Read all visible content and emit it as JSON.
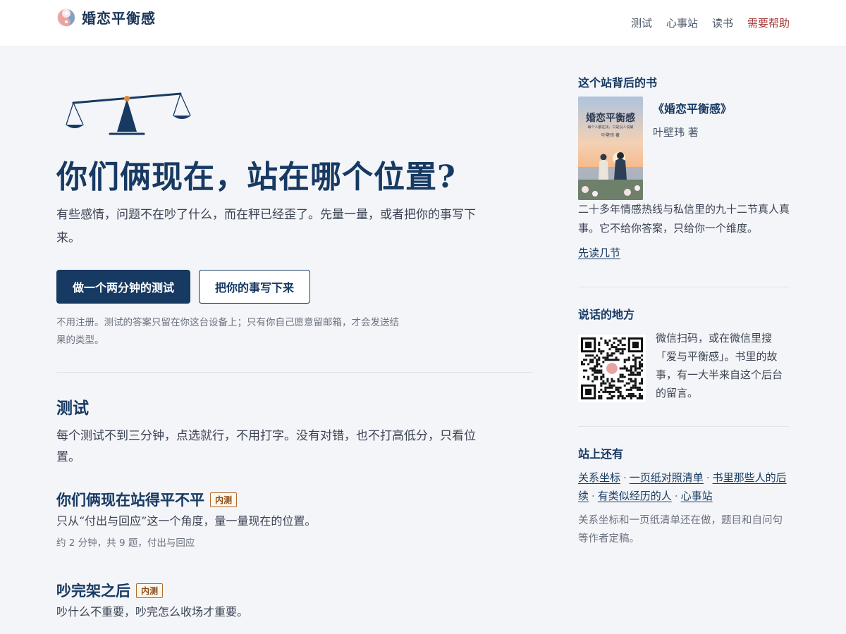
{
  "header": {
    "brand": "婚恋平衡感",
    "nav": {
      "test": "测试",
      "station": "心事站",
      "read": "读书",
      "help": "需要帮助"
    }
  },
  "hero": {
    "title": "你们俩现在，站在哪个位置?",
    "desc": "有些感情，问题不在吵了什么，而在秤已经歪了。先量一量，或者把你的事写下来。",
    "primary_button": "做一个两分钟的测试",
    "secondary_button": "把你的事写下来",
    "note": "不用注册。测试的答案只留在你这台设备上；只有你自己愿意留邮箱，才会发送结果的类型。"
  },
  "tests_section": {
    "title": "测试",
    "desc": "每个测试不到三分钟，点选就行，不用打字。没有对错，也不打高低分，只看位置。",
    "items": [
      {
        "title": "你们俩现在站得平不平",
        "badge": "内测",
        "desc": "只从“付出与回应”这一个角度，量一量现在的位置。",
        "meta": "约 2 分钟，共 9 题，付出与回应"
      },
      {
        "title": "吵完架之后",
        "badge": "内测",
        "desc": "吵什么不重要，吵完怎么收场才重要。",
        "meta": ""
      }
    ]
  },
  "sidebar": {
    "book": {
      "heading": "这个站背后的书",
      "cover_title": "婚恋平衡感",
      "cover_subtitle": "每个人都在找，只是没人说破",
      "cover_author": "叶壁玮 著",
      "name": "《婚恋平衡感》",
      "author": "叶壁玮 著",
      "desc": "二十多年情感热线与私信里的九十二节真人真事。它不给你答案，只给你一个维度。",
      "link": "先读几节"
    },
    "talk": {
      "heading": "说话的地方",
      "desc": "微信扫码，或在微信里搜「爱与平衡感」。书里的故事，有一大半来自这个后台的留言。"
    },
    "more": {
      "heading": "站上还有",
      "links": [
        "关系坐标",
        "一页纸对照清单",
        "书里那些人的后续",
        "有类似经历的人",
        "心事站"
      ],
      "note": "关系坐标和一页纸清单还在做，题目和自问句等作者定稿。"
    }
  },
  "colors": {
    "accent": "#173a63",
    "help": "#a63a3a",
    "badge": "#b06a2b",
    "background": "#f4f5f8"
  }
}
